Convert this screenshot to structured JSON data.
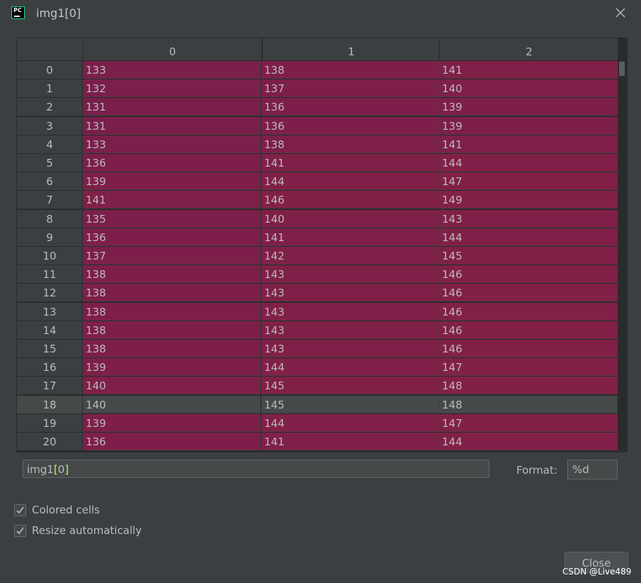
{
  "window": {
    "title": "img1[0]",
    "app_icon": "pycharm-logo-icon",
    "close_icon": "close-icon"
  },
  "table": {
    "columns": [
      "0",
      "1",
      "2"
    ],
    "rows": [
      {
        "index": "0",
        "values": [
          "133",
          "138",
          "141"
        ]
      },
      {
        "index": "1",
        "values": [
          "132",
          "137",
          "140"
        ]
      },
      {
        "index": "2",
        "values": [
          "131",
          "136",
          "139"
        ]
      },
      {
        "index": "3",
        "values": [
          "131",
          "136",
          "139"
        ]
      },
      {
        "index": "4",
        "values": [
          "133",
          "138",
          "141"
        ]
      },
      {
        "index": "5",
        "values": [
          "136",
          "141",
          "144"
        ]
      },
      {
        "index": "6",
        "values": [
          "139",
          "144",
          "147"
        ]
      },
      {
        "index": "7",
        "values": [
          "141",
          "146",
          "149"
        ]
      },
      {
        "index": "8",
        "values": [
          "135",
          "140",
          "143"
        ]
      },
      {
        "index": "9",
        "values": [
          "136",
          "141",
          "144"
        ]
      },
      {
        "index": "10",
        "values": [
          "137",
          "142",
          "145"
        ]
      },
      {
        "index": "11",
        "values": [
          "138",
          "143",
          "146"
        ]
      },
      {
        "index": "12",
        "values": [
          "138",
          "143",
          "146"
        ]
      },
      {
        "index": "13",
        "values": [
          "138",
          "143",
          "146"
        ]
      },
      {
        "index": "14",
        "values": [
          "138",
          "143",
          "146"
        ]
      },
      {
        "index": "15",
        "values": [
          "138",
          "143",
          "146"
        ]
      },
      {
        "index": "16",
        "values": [
          "139",
          "144",
          "147"
        ]
      },
      {
        "index": "17",
        "values": [
          "140",
          "145",
          "148"
        ]
      },
      {
        "index": "18",
        "values": [
          "140",
          "145",
          "148"
        ],
        "selected": true
      },
      {
        "index": "19",
        "values": [
          "139",
          "144",
          "147"
        ]
      },
      {
        "index": "20",
        "values": [
          "136",
          "141",
          "144"
        ]
      }
    ],
    "cell_color_low": "#7a1f4c",
    "cell_color_high": "#832046"
  },
  "expression": {
    "prefix": "img1",
    "bracket_open": "[",
    "index": "0",
    "bracket_close": "]"
  },
  "format": {
    "label": "Format:",
    "value": "%d"
  },
  "options": {
    "colored_cells": {
      "label": "Colored cells",
      "checked": true
    },
    "resize_automatically": {
      "label": "Resize automatically",
      "checked": true
    }
  },
  "buttons": {
    "close_label": "Close"
  },
  "watermark": "CSDN @Live489"
}
